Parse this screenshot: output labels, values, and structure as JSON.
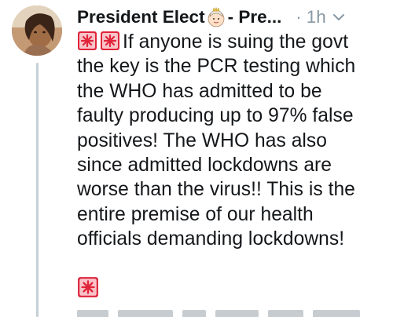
{
  "tweet": {
    "display_name": "President Elect",
    "handle_fragment": "- Pre...",
    "time_dot": "·",
    "timestamp": "1h",
    "text": "If anyone is suing the govt the key is the PCR testing which the WHO has admitted to be faulty producing up to 97% false positives! The WHO has also since admitted lockdowns are worse than the virus!! This is the entire premise of our health officials demanding lockdowns!",
    "lines": [
      "If anyone is suing the govt",
      "the key is the PCR testing which",
      "the WHO has admitted to be",
      "faulty producing up to 97% false",
      "positives! The WHO has also",
      "since admitted lockdowns are",
      "worse than the virus!! This is the",
      "entire premise of our health",
      "officials demanding lockdowns!"
    ]
  },
  "icons": {
    "avatar": "profile-photo",
    "name_emoji": "princess-emoji",
    "siren": "police-car-light-emoji",
    "menu": "chevron-down-icon"
  },
  "colors": {
    "text": "#14171a",
    "muted": "#8899a6",
    "siren_red": "#e0243a",
    "thread_line": "#c4cfd6"
  }
}
